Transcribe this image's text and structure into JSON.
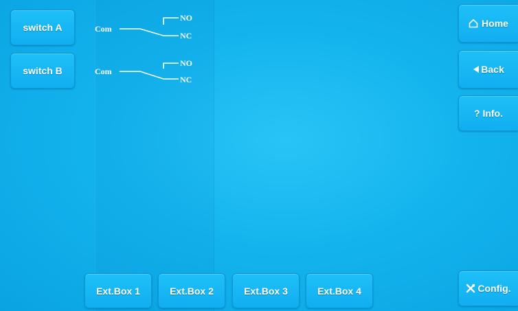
{
  "left_buttons": {
    "switch_a": "switch A",
    "switch_b": "switch B"
  },
  "relays": [
    {
      "com": "Com",
      "no": "NO",
      "nc": "NC"
    },
    {
      "com": "Com",
      "no": "NO",
      "nc": "NC"
    }
  ],
  "right_nav": {
    "home": "Home",
    "back": "Back",
    "info": "? Info.",
    "config": "Config."
  },
  "ext_boxes": [
    "Ext.Box 1",
    "Ext.Box 2",
    "Ext.Box 3",
    "Ext.Box 4"
  ],
  "colors": {
    "background": "#13b4ee",
    "button": "#1ec0f8",
    "text": "#ffffff"
  },
  "icons": {
    "home": "house-icon",
    "back": "left-triangle-icon",
    "config": "tools-icon"
  }
}
